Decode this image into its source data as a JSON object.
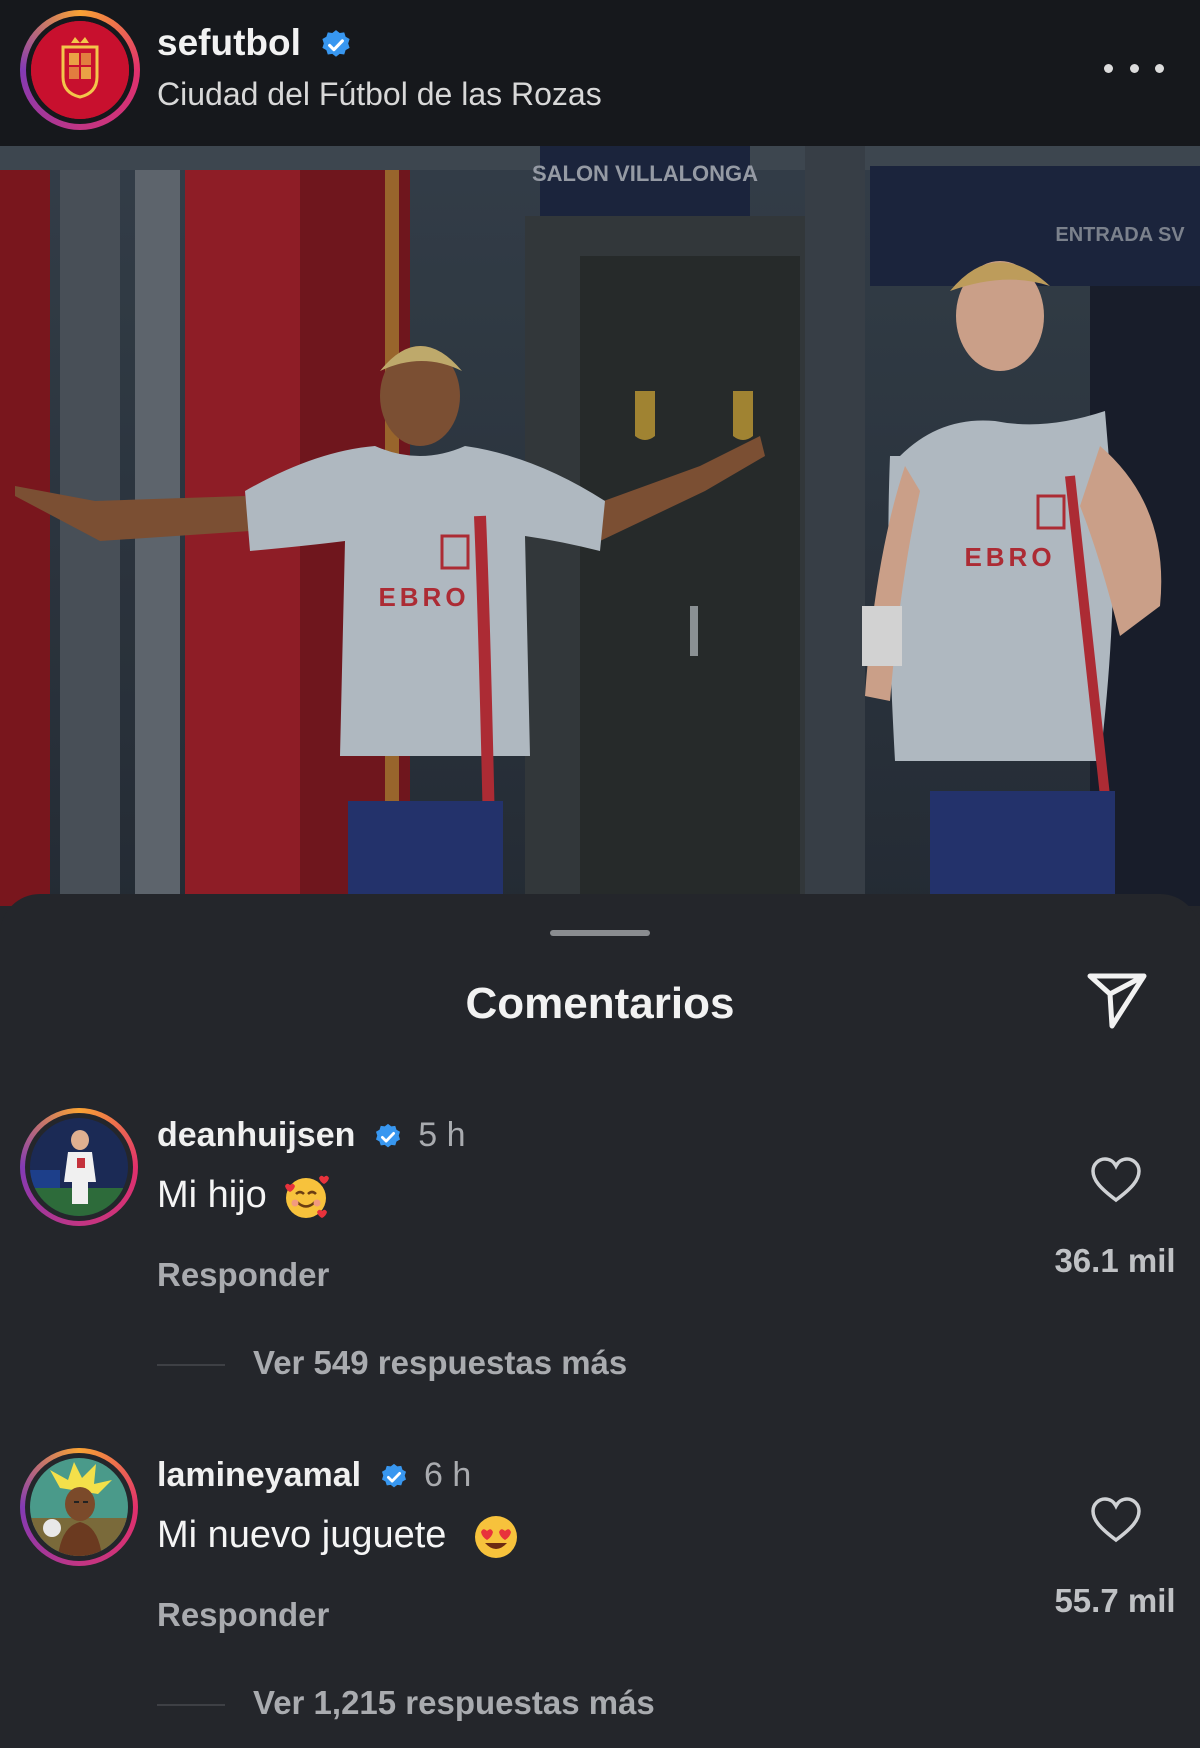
{
  "post": {
    "username": "sefutbol",
    "location": "Ciudad del Fútbol de las Rozas",
    "photo_signs": [
      "SALON VILLALONGA",
      "ENTRADA SV"
    ],
    "jersey_text": "EBRO"
  },
  "comments_sheet": {
    "title": "Comentarios",
    "comments": [
      {
        "username": "deanhuijsen",
        "time": "5 h",
        "text": "Mi hijo",
        "emoji": "smiling-face-with-hearts",
        "reply_label": "Responder",
        "likes": "36.1 mil",
        "more_replies": "Ver 549 respuestas más"
      },
      {
        "username": "lamineyamal",
        "time": "6 h",
        "text": "Mi nuevo juguete",
        "emoji": "heart-eyes",
        "reply_label": "Responder",
        "likes": "55.7 mil",
        "more_replies": "Ver 1,215 respuestas más"
      }
    ]
  },
  "colors": {
    "header_bg": "#16181c",
    "sheet_bg": "#24262b",
    "verified_blue": "#3897f0",
    "spain_red": "#c8102e"
  },
  "icons": [
    "verified-badge-icon",
    "more-options-icon",
    "share-icon",
    "heart-icon"
  ]
}
